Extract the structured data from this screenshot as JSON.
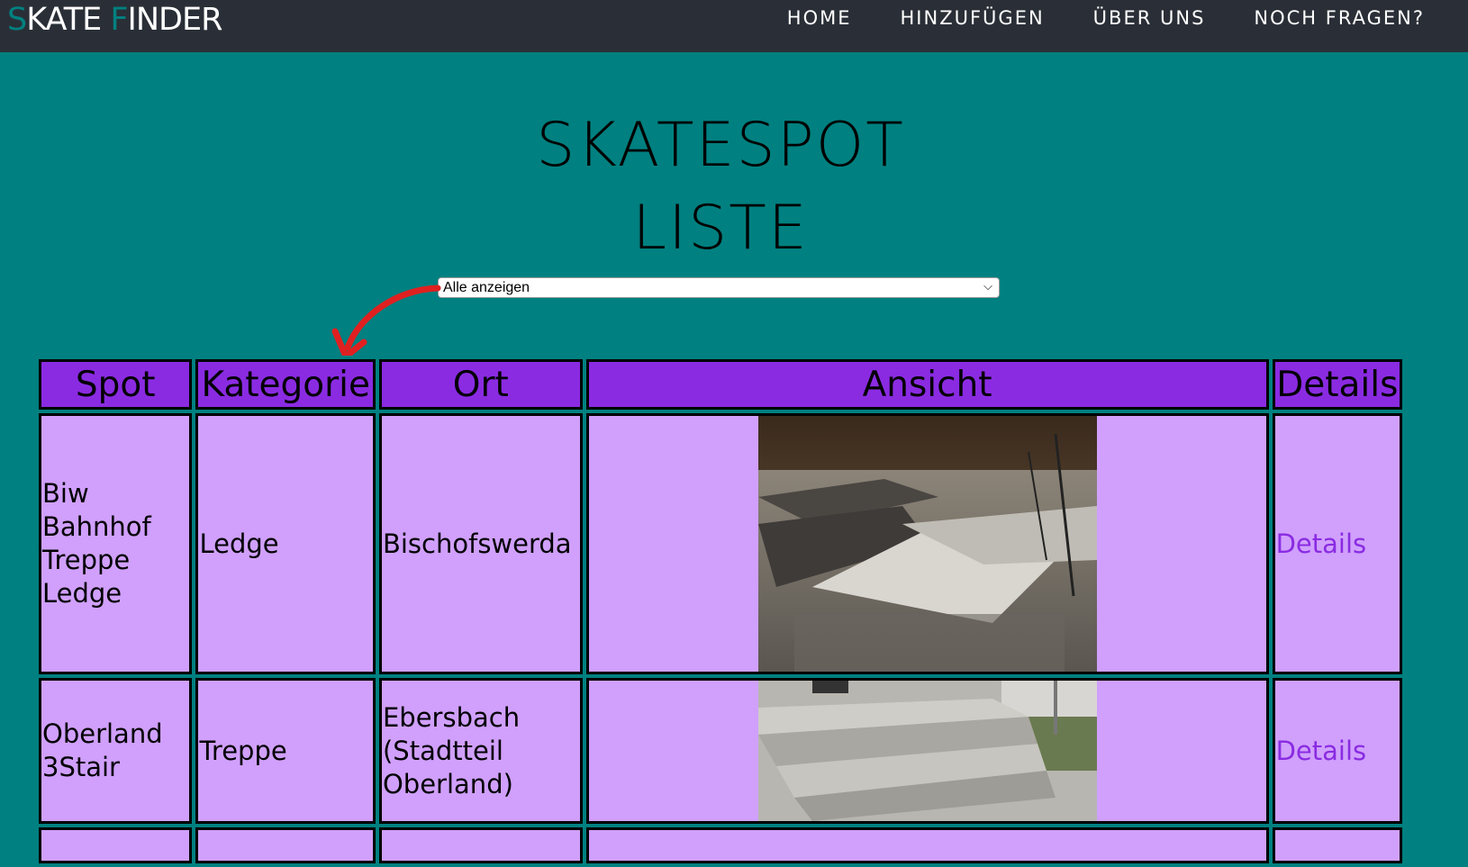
{
  "nav": {
    "brand_first_letter": "S",
    "brand_part_1": "KATE ",
    "brand_second_letter": "F",
    "brand_part_2": "INDER",
    "links": [
      "HOME",
      "HINZUFÜGEN",
      "ÜBER UNS",
      "NOCH FRAGEN?"
    ]
  },
  "page": {
    "title_line_1": "SKATESPOT",
    "title_line_2": "LISTE"
  },
  "filter": {
    "selected": "Alle anzeigen"
  },
  "table": {
    "headers": [
      "Spot",
      "Kategorie",
      "Ort",
      "Ansicht",
      "Details"
    ],
    "rows": [
      {
        "spot_lines": [
          "Biw",
          "Bahnhof",
          "Treppe",
          "Ledge"
        ],
        "kategorie": "Ledge",
        "ort_lines": [
          "Bischofswerda"
        ],
        "details": "Details"
      },
      {
        "spot_lines": [
          "Oberland",
          "3Stair"
        ],
        "kategorie": "Treppe",
        "ort_lines": [
          "Ebersbach",
          "(Stadtteil",
          "Oberland)"
        ],
        "details": "Details"
      }
    ]
  },
  "colors": {
    "background": "#008080",
    "navbar": "#2a2f37",
    "header_cell": "#8a2be2",
    "body_cell": "#d0a0fc",
    "link": "#8a2be2",
    "annotation_arrow": "#e02020"
  },
  "icons": {
    "select_arrow": "chevron-down-icon"
  }
}
